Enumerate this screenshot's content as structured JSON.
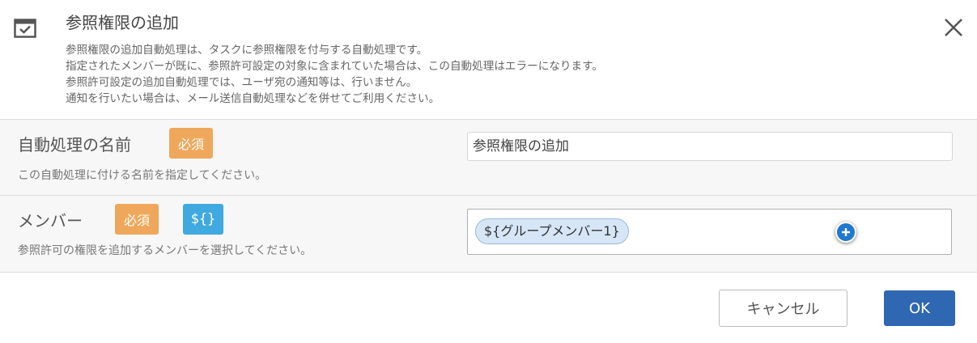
{
  "dialog": {
    "title": "参照権限の追加",
    "icon": "calendar-check-icon",
    "description": [
      "参照権限の追加自動処理は、タスクに参照権限を付与する自動処理です。",
      "指定されたメンバーが既に、参照許可設定の対象に含まれていた場合は、この自動処理はエラーになります。",
      "参照許可設定の追加自動処理では、ユーザ宛の通知等は、行いません。",
      "通知を行いたい場合は、メール送信自動処理などを併せてご利用ください。"
    ],
    "close_icon": "close-icon"
  },
  "fields": {
    "name": {
      "label": "自動処理の名前",
      "required_badge": "必須",
      "help": "この自動処理に付ける名前を指定してください。",
      "value": "参照権限の追加"
    },
    "member": {
      "label": "メンバー",
      "required_badge": "必須",
      "variable_badge": "${}",
      "help": "参照許可の権限を追加するメンバーを選択してください。",
      "chips": [
        "${グループメンバー1}"
      ],
      "add_icon": "plus-circle-icon"
    }
  },
  "buttons": {
    "cancel": "キャンセル",
    "ok": "OK"
  },
  "colors": {
    "required_badge": "#efa85b",
    "variable_badge": "#3fa9e0",
    "ok_button": "#2f67b3",
    "chip_bg": "#d6e6f7",
    "add_button": "#1f78d1"
  }
}
